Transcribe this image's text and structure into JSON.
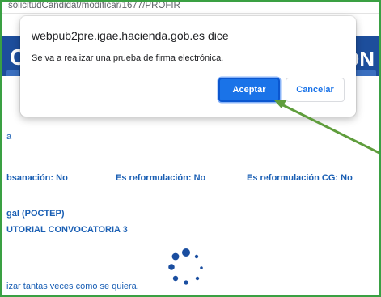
{
  "browser": {
    "url_text": "solicitudCandidat/modificar/1677/PROFIR"
  },
  "header": {
    "left_text": "Co",
    "right_text": "ON"
  },
  "page": {
    "fragment_a": "a",
    "subsanacion": "bsanación: No",
    "reformulacion": "Es reformulación: No",
    "reformulacion_cg": "Es reformulación CG: No",
    "program": "gal (POCTEP)",
    "convocatoria": "UTORIAL CONVOCATORIA 3",
    "footer_note": "izar tantas veces como se quiera."
  },
  "dialog": {
    "title": "webpub2pre.igae.hacienda.gob.es dice",
    "message": "Se va a realizar una prueba de firma electrónica.",
    "accept_label": "Aceptar",
    "cancel_label": "Cancelar"
  },
  "colors": {
    "frame": "#3aa043",
    "header": "#1d4e9c",
    "link_text": "#1a5fb4",
    "primary_button": "#1a73e8",
    "annotation_arrow": "#5f9d3c"
  },
  "icons": {
    "spinner": "loading-spinner-icon",
    "annotation": "annotation-arrow"
  }
}
